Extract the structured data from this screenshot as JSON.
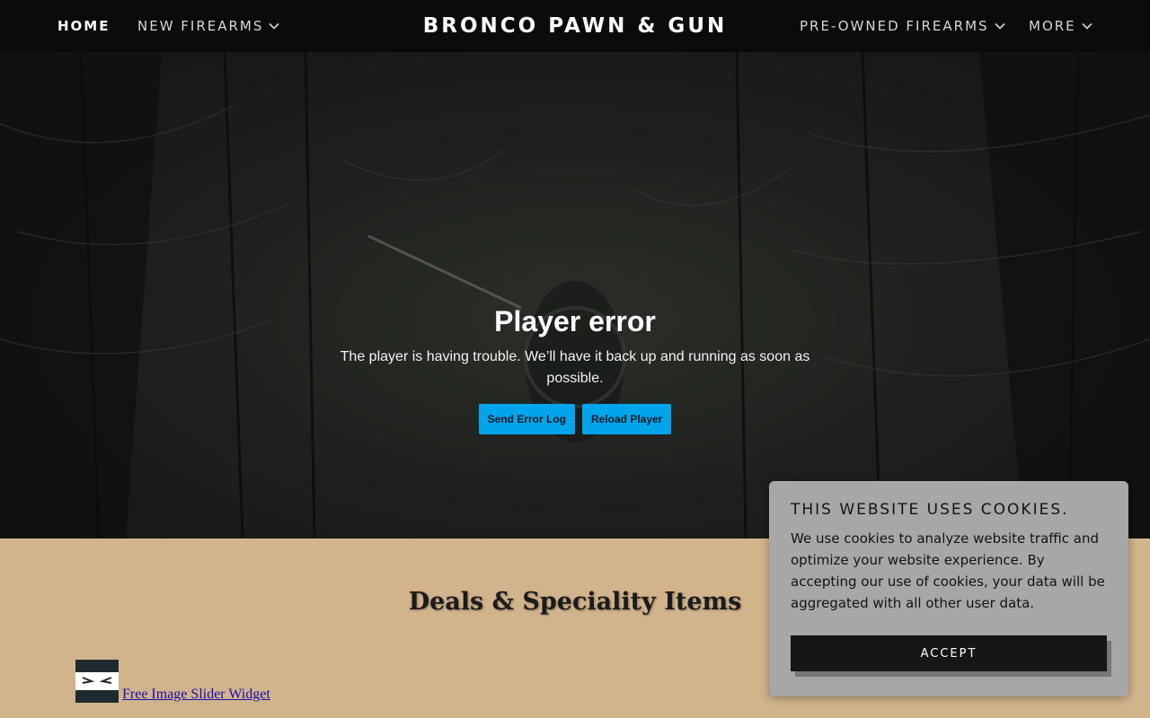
{
  "header": {
    "brand": "BRONCO PAWN & GUN",
    "nav_left": [
      {
        "label": "HOME",
        "has_dropdown": false,
        "active": true
      },
      {
        "label": "NEW FIREARMS",
        "has_dropdown": true,
        "active": false
      }
    ],
    "nav_right": [
      {
        "label": "PRE-OWNED FIREARMS",
        "has_dropdown": true
      },
      {
        "label": "MORE",
        "has_dropdown": true
      }
    ]
  },
  "player": {
    "error_title": "Player error",
    "error_message": "The player is having trouble. We’ll have it back up and running as soon as possible.",
    "send_log_label": "Send Error Log",
    "reload_label": "Reload Player",
    "button_color": "#02a4ea"
  },
  "section": {
    "title": "Deals & Speciality Items",
    "background_color": "#d2b48c"
  },
  "widget": {
    "link_text": "Free Image Slider Widget"
  },
  "cookie_banner": {
    "title": "THIS WEBSITE USES COOKIES.",
    "message": "We use cookies to analyze website traffic and optimize your website experience. By accepting our use of cookies, your data will be aggregated with all other user data.",
    "accept_label": "ACCEPT"
  }
}
